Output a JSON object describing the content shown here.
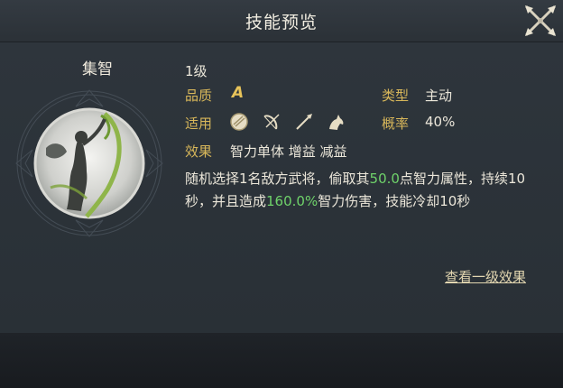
{
  "header": {
    "title": "技能预览"
  },
  "skill": {
    "name": "集智",
    "level": "1级",
    "quality_label": "品质",
    "quality_value": "A",
    "type_label": "类型",
    "type_value": "主动",
    "applies_label": "适用",
    "applies_icons": [
      "shield-icon",
      "bow-icon",
      "spear-icon",
      "horse-icon"
    ],
    "rate_label": "概率",
    "rate_value": "40%",
    "effect_label": "效果",
    "effect_tags": "智力单体 增益 减益",
    "description": {
      "part1": "随机选择1名敌方武将，偷取其",
      "value1": "50.0",
      "part2": "点智力属性，持续10秒，并且造成",
      "value2": "160.0%",
      "part3": "智力伤害，技能冷却10秒"
    }
  },
  "actions": {
    "view_level1": "查看一级效果"
  },
  "colors": {
    "gold": "#d8b75a",
    "green": "#6fd26a",
    "background": "#2c3238"
  }
}
